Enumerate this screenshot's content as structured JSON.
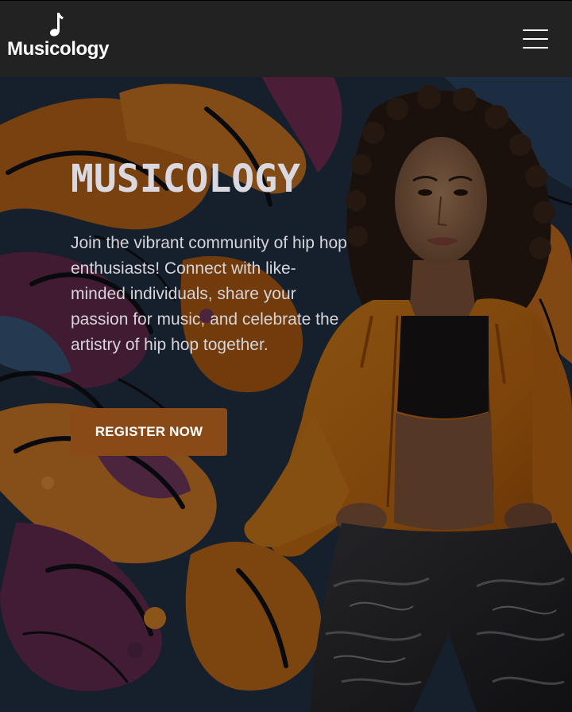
{
  "navbar": {
    "brand_name": "Musicology",
    "brand_icon": "music-note-icon",
    "menu_icon": "hamburger-menu-icon"
  },
  "hero": {
    "title": "MUSICOLOGY",
    "description": "Join the vibrant community of hip hop enthusiasts! Connect with like-minded individuals, share your passion for music, and celebrate the artistry of hip hop together.",
    "cta_label": "REGISTER NOW",
    "background_image": "graffiti-wall-with-woman-in-orange-jacket"
  },
  "colors": {
    "navbar_bg": "#222222",
    "cta_bg": "#8a4a18",
    "text_light": "#d5d5da"
  }
}
